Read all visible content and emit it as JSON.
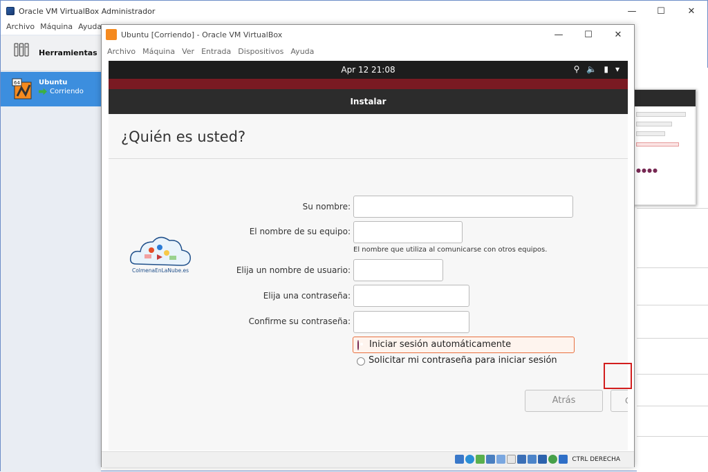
{
  "manager": {
    "title": "Oracle VM VirtualBox Administrador",
    "menu": [
      "Archivo",
      "Máquina",
      "Ayuda"
    ],
    "tools_label": "Herramientas",
    "vm_name": "Ubuntu",
    "vm_state": "Corriendo",
    "vm_badge": "64"
  },
  "vm_window": {
    "title": "Ubuntu [Corriendo] - Oracle VM VirtualBox",
    "menu": [
      "Archivo",
      "Máquina",
      "Ver",
      "Entrada",
      "Dispositivos",
      "Ayuda"
    ],
    "host_key": "CTRL DERECHA"
  },
  "ubuntu": {
    "clock": "Apr 12  21:08",
    "installer_title": "Instalar",
    "heading": "¿Quién es usted?",
    "logo_text": "ColmenaEnLaNube.es",
    "form": {
      "name_label": "Su nombre:",
      "name_value": "",
      "computer_label": "El nombre de su equipo:",
      "computer_value": "",
      "computer_hint": "El nombre que utiliza al comunicarse con otros equipos.",
      "username_label": "Elija un nombre de usuario:",
      "username_value": "",
      "password_label": "Elija una contraseña:",
      "password_value": "",
      "confirm_label": "Confirme su contraseña:",
      "confirm_value": ""
    },
    "login_options": {
      "auto_label": "Iniciar sesión automáticamente",
      "auto_selected": true,
      "password_label": "Solicitar mi contraseña para iniciar sesión",
      "password_selected": false
    },
    "buttons": {
      "back": "Atrás",
      "continue": "C"
    },
    "progress_steps": 7
  },
  "colors": {
    "ubuntu_aubergine": "#772953",
    "focus_orange": "#e8703f",
    "highlight_red": "#d21d1d",
    "selection_blue": "#3c8ede"
  }
}
